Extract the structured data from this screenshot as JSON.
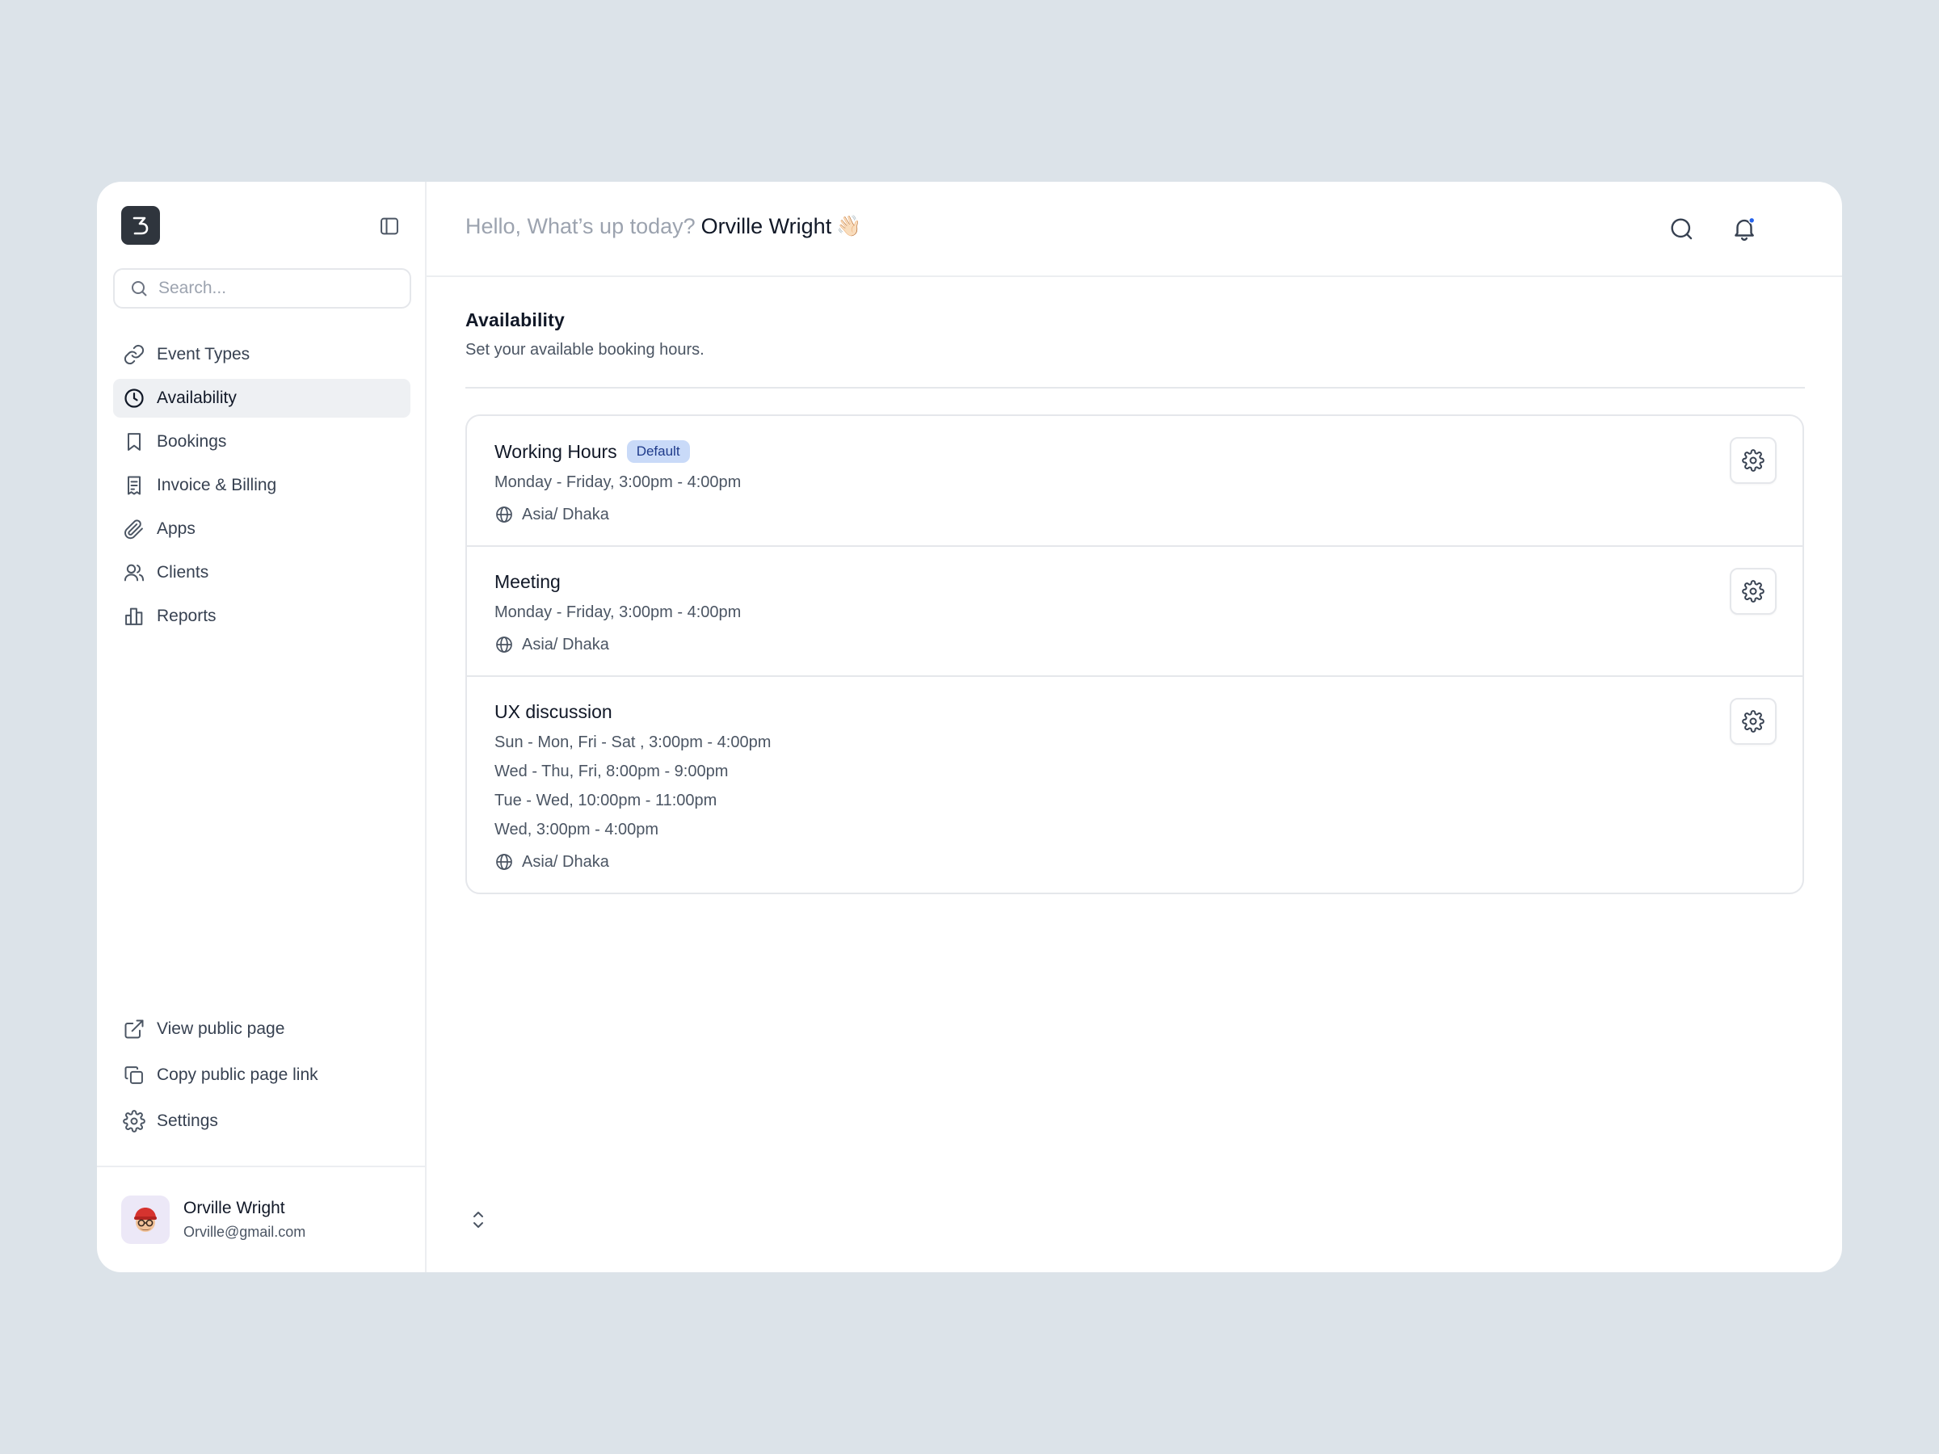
{
  "header": {
    "greeting": "Hello, What’s up today?",
    "user_name": "Orville Wright",
    "wave_emoji": "👋🏻"
  },
  "sidebar": {
    "search_placeholder": "Search...",
    "items": [
      {
        "label": "Event Types",
        "icon": "link-icon"
      },
      {
        "label": "Availability",
        "icon": "clock-icon",
        "active": true
      },
      {
        "label": "Bookings",
        "icon": "bookmark-icon"
      },
      {
        "label": "Invoice & Billing",
        "icon": "receipt-icon"
      },
      {
        "label": "Apps",
        "icon": "paperclip-icon"
      },
      {
        "label": "Clients",
        "icon": "users-icon"
      },
      {
        "label": "Reports",
        "icon": "bar-chart-icon"
      }
    ],
    "bottom_items": [
      {
        "label": "View public page",
        "icon": "external-link-icon"
      },
      {
        "label": "Copy public page link",
        "icon": "copy-icon"
      },
      {
        "label": "Settings",
        "icon": "gear-icon"
      }
    ],
    "user": {
      "name": "Orville Wright",
      "email": "Orville@gmail.com"
    }
  },
  "page": {
    "title": "Availability",
    "subtitle": "Set your available booking hours."
  },
  "schedules": [
    {
      "title": "Working Hours",
      "badge": "Default",
      "lines": [
        "Monday - Friday, 3:00pm - 4:00pm"
      ],
      "timezone": "Asia/ Dhaka"
    },
    {
      "title": "Meeting",
      "lines": [
        "Monday - Friday, 3:00pm - 4:00pm"
      ],
      "timezone": "Asia/ Dhaka"
    },
    {
      "title": "UX discussion",
      "lines": [
        "Sun - Mon, Fri - Sat , 3:00pm - 4:00pm",
        "Wed - Thu, Fri, 8:00pm - 9:00pm",
        "Tue - Wed, 10:00pm - 11:00pm",
        "Wed, 3:00pm - 4:00pm"
      ],
      "timezone": "Asia/ Dhaka"
    }
  ],
  "colors": {
    "background": "#dce3e9",
    "active_nav": "#eef0f3",
    "badge_bg": "#c9daf8",
    "notification_dot": "#2563eb"
  }
}
